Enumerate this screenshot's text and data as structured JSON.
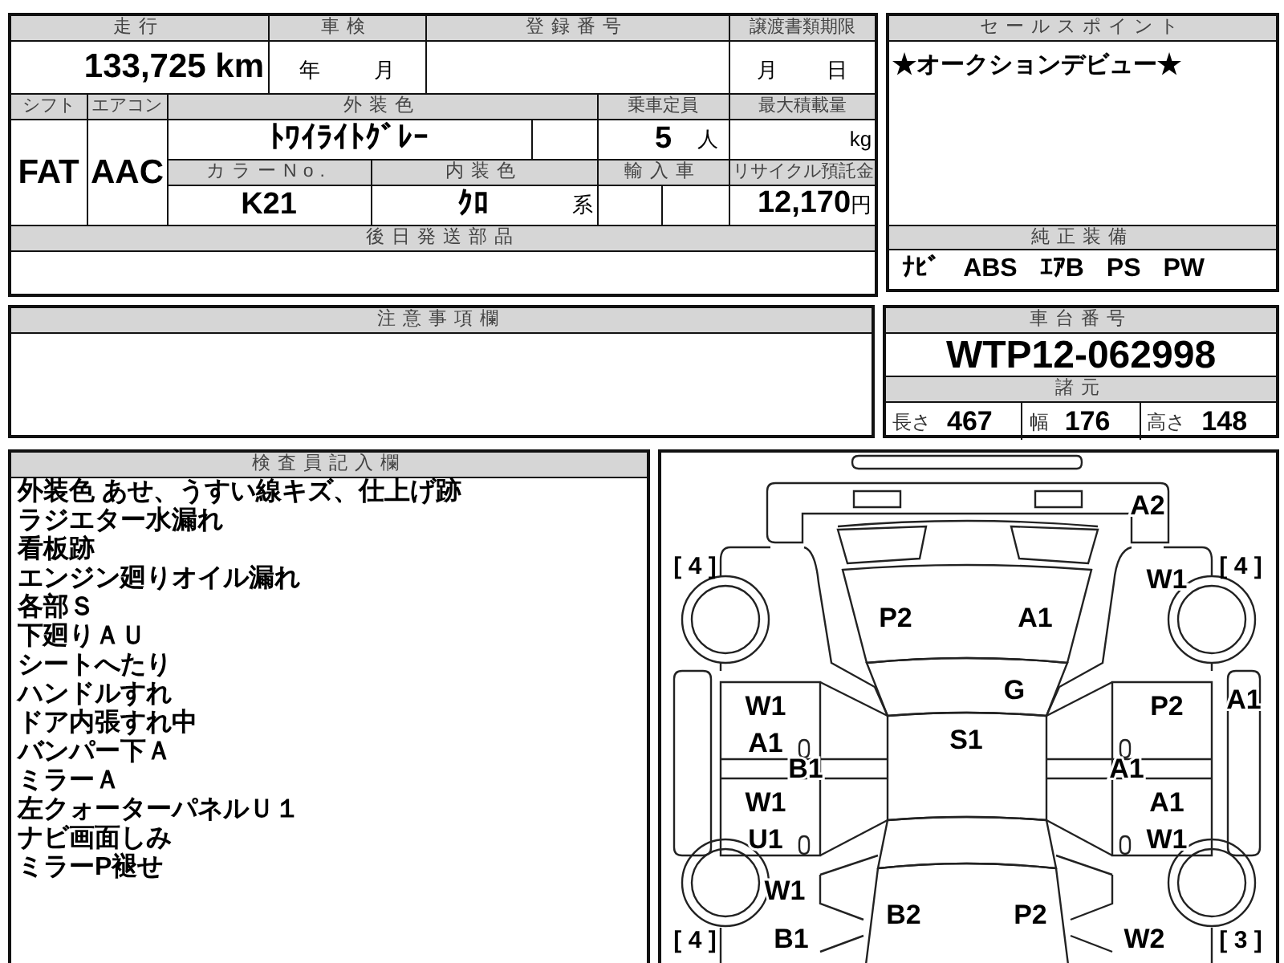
{
  "main_table": {
    "mileage": {
      "label": "走行",
      "value": "133,725 km"
    },
    "inspection_expiry": {
      "label": "車検",
      "year_unit": "年",
      "month_unit": "月"
    },
    "registration_number": {
      "label": "登録番号"
    },
    "transfer_docs_deadline": {
      "label": "譲渡書類期限",
      "month_unit": "月",
      "day_unit": "日"
    },
    "shift": {
      "label": "シフト",
      "value": "FAT"
    },
    "air_conditioner": {
      "label": "エアコン",
      "value": "AAC"
    },
    "exterior_color": {
      "label": "外装色",
      "value": "ﾄﾜｲﾗｲﾄｸﾞﾚｰ"
    },
    "seating_capacity": {
      "label": "乗車定員",
      "value": "5",
      "unit": "人"
    },
    "max_load": {
      "label": "最大積載量",
      "unit": "kg"
    },
    "color_number": {
      "label": "カラーNo.",
      "value": "K21"
    },
    "interior_color": {
      "label": "内装色",
      "value": "ｸﾛ",
      "suffix": "系"
    },
    "imported": {
      "label": "輸入車"
    },
    "recycling_deposit": {
      "label": "リサイクル預託金",
      "value": "12,170",
      "unit": "円"
    },
    "parts_to_ship_later": {
      "label": "後日発送部品"
    }
  },
  "sales_point": {
    "label": "セールスポイント",
    "text": "★オークションデビュー★"
  },
  "equipment": {
    "label": "純正装備",
    "items": [
      "ﾅﾋﾞ",
      "ABS",
      "ｴｱB",
      "PS",
      "PW"
    ]
  },
  "notes": {
    "label": "注意事項欄"
  },
  "chassis": {
    "label": "車台番号",
    "value": "WTP12-062998"
  },
  "specs": {
    "label": "諸元",
    "items": [
      {
        "label": "長さ",
        "value": "467"
      },
      {
        "label": "幅",
        "value": "176"
      },
      {
        "label": "高さ",
        "value": "148"
      }
    ]
  },
  "inspector_notes": {
    "label": "検査員記入欄",
    "lines": [
      "外装色 あせ、うすい線キズ、仕上げ跡",
      "ラジエター水漏れ",
      "看板跡",
      "エンジン廻りオイル漏れ",
      "各部Ｓ",
      "下廻りＡＵ",
      "シートへたり",
      "ハンドルすれ",
      "ドア内張すれ中",
      "バンパー下Ａ",
      "ミラーＡ",
      "左クォーターパネルＵ１",
      "ナビ画面しみ",
      "ミラーP褪せ"
    ]
  },
  "damage_diagram": {
    "tire_ratings": [
      "[ 4 ]",
      "[ 4 ]",
      "[ 4 ]",
      "[ 3 ]"
    ],
    "marks": [
      "A2",
      "W1",
      "P2",
      "A1",
      "G",
      "W1",
      "S1",
      "P2",
      "A1",
      "A1",
      "B1",
      "A1",
      "W1",
      "A1",
      "U1",
      "W1",
      "W1",
      "B2",
      "P2",
      "B1",
      "W2"
    ]
  }
}
